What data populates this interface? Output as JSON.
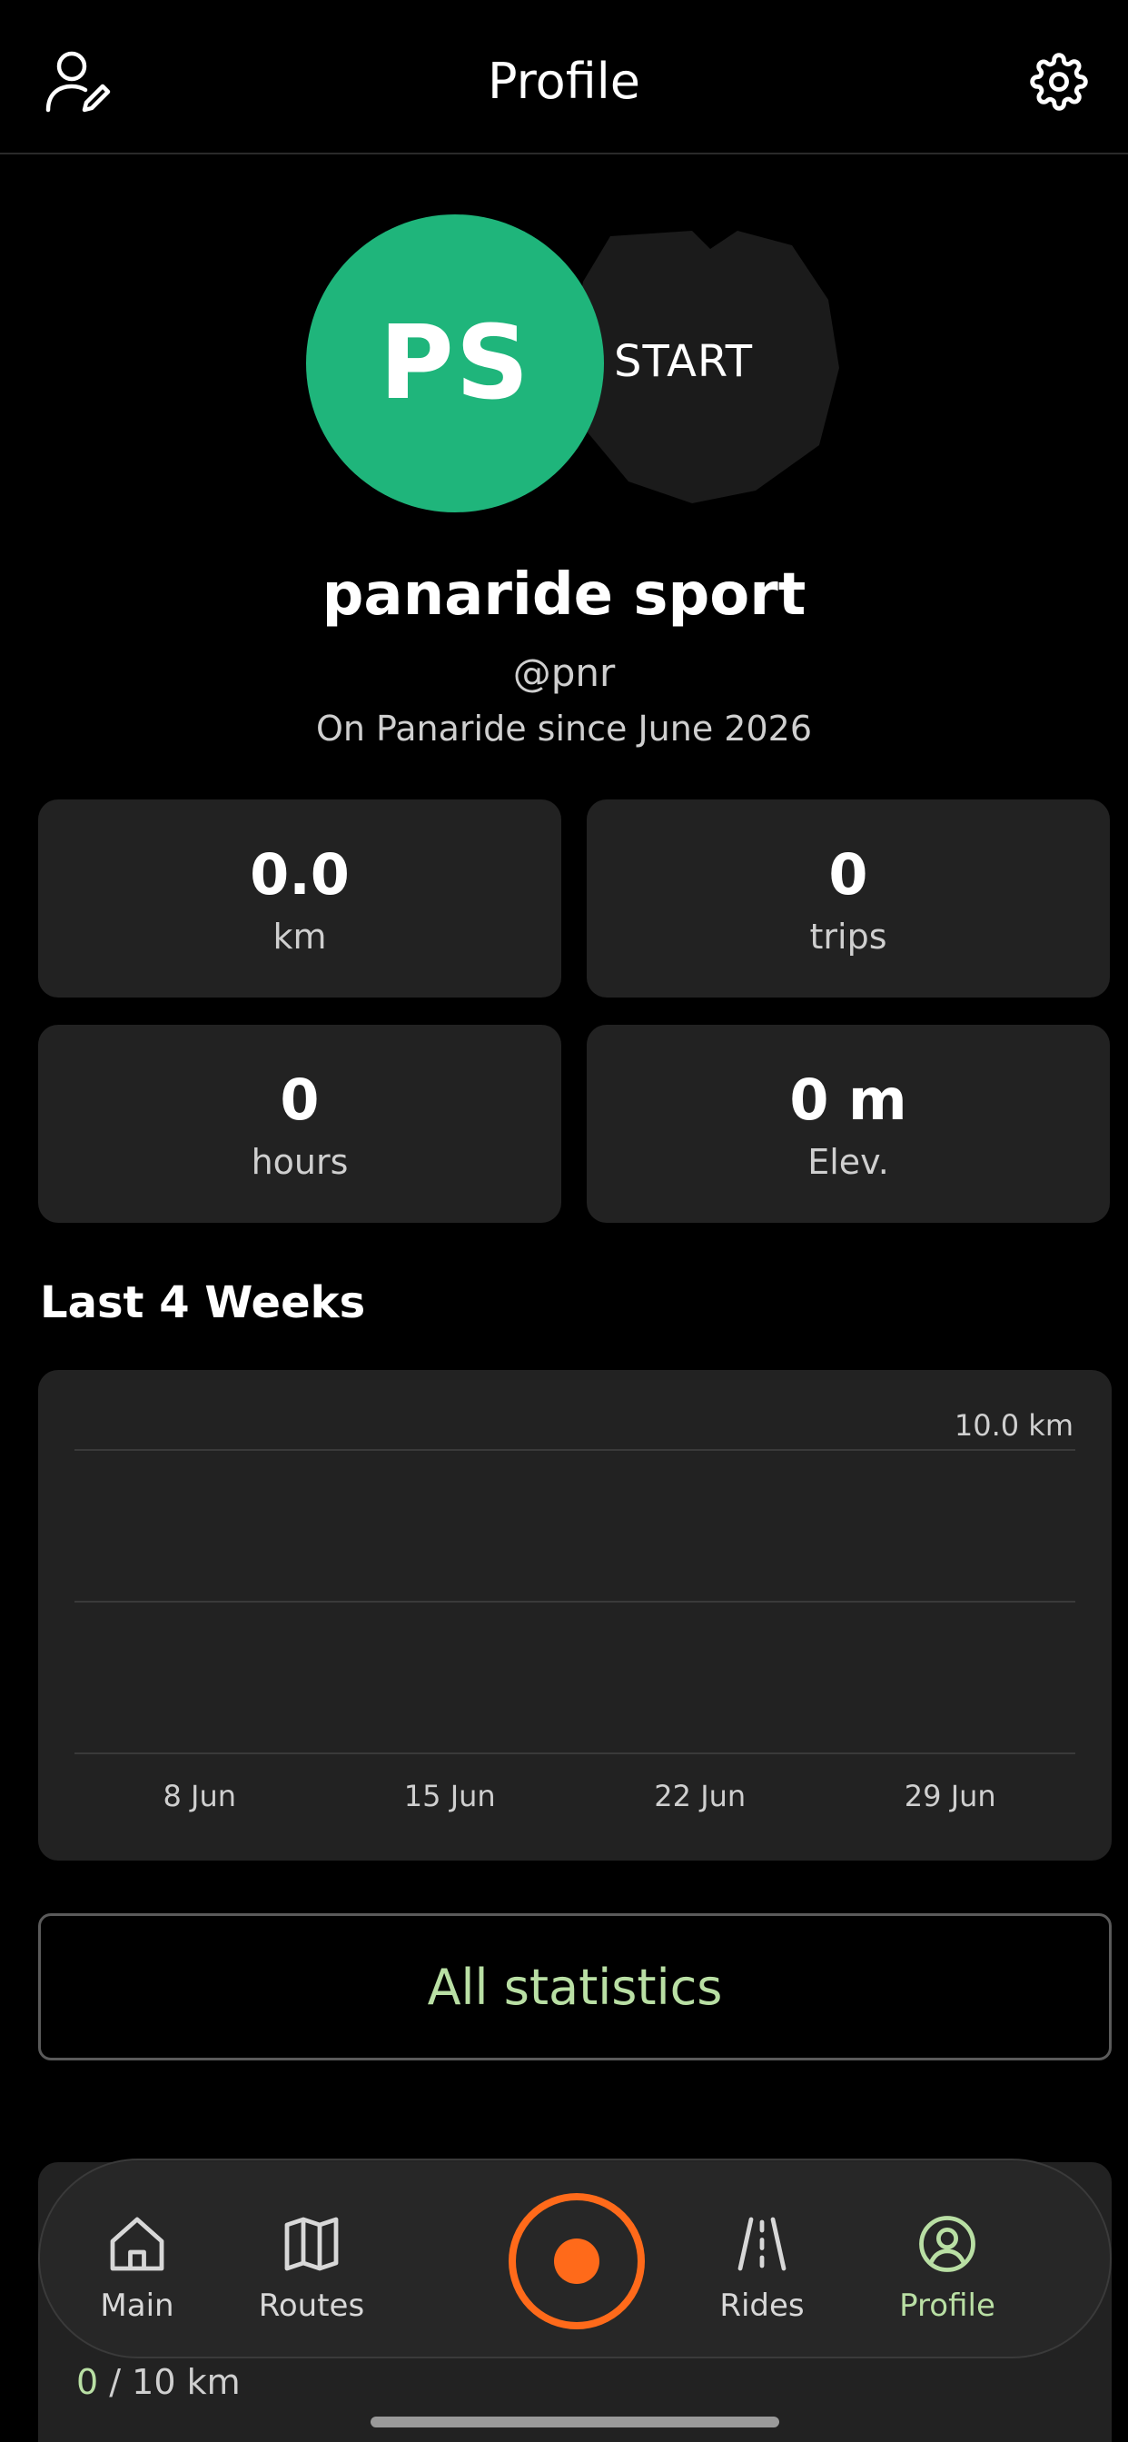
{
  "header": {
    "title": "Profile",
    "left_icon": "edit-profile-icon",
    "right_icon": "gear-icon"
  },
  "profile": {
    "initials": "PS",
    "badge_label": "START",
    "name": "panaride sport",
    "handle": "@pnr",
    "since": "On Panaride since June 2026",
    "avatar_color": "#1fb57b"
  },
  "stats": [
    {
      "value": "0.0",
      "label": "km"
    },
    {
      "value": "0",
      "label": "trips"
    },
    {
      "value": "0",
      "label": "hours"
    },
    {
      "value": "0 m",
      "label": "Elev."
    }
  ],
  "weeks": {
    "title": "Last 4 Weeks",
    "chart_data": {
      "type": "bar",
      "categories": [
        "8 Jun",
        "15 Jun",
        "22 Jun",
        "29 Jun"
      ],
      "values": [
        0,
        0,
        0,
        0
      ],
      "ylim": [
        0,
        10
      ],
      "max_label": "10.0 km",
      "grid": true
    }
  },
  "all_stats_label": "All statistics",
  "goal": {
    "current": "0",
    "rest": " / 10 km"
  },
  "nav": {
    "items": [
      {
        "label": "Main",
        "icon": "home-icon"
      },
      {
        "label": "Routes",
        "icon": "map-icon"
      },
      {
        "label": "Rides",
        "icon": "road-icon"
      },
      {
        "label": "Profile",
        "icon": "profile-circle-icon"
      }
    ],
    "record_icon": "record-icon",
    "accent": "#ff6a1a",
    "active_color": "#b9dfa4"
  }
}
